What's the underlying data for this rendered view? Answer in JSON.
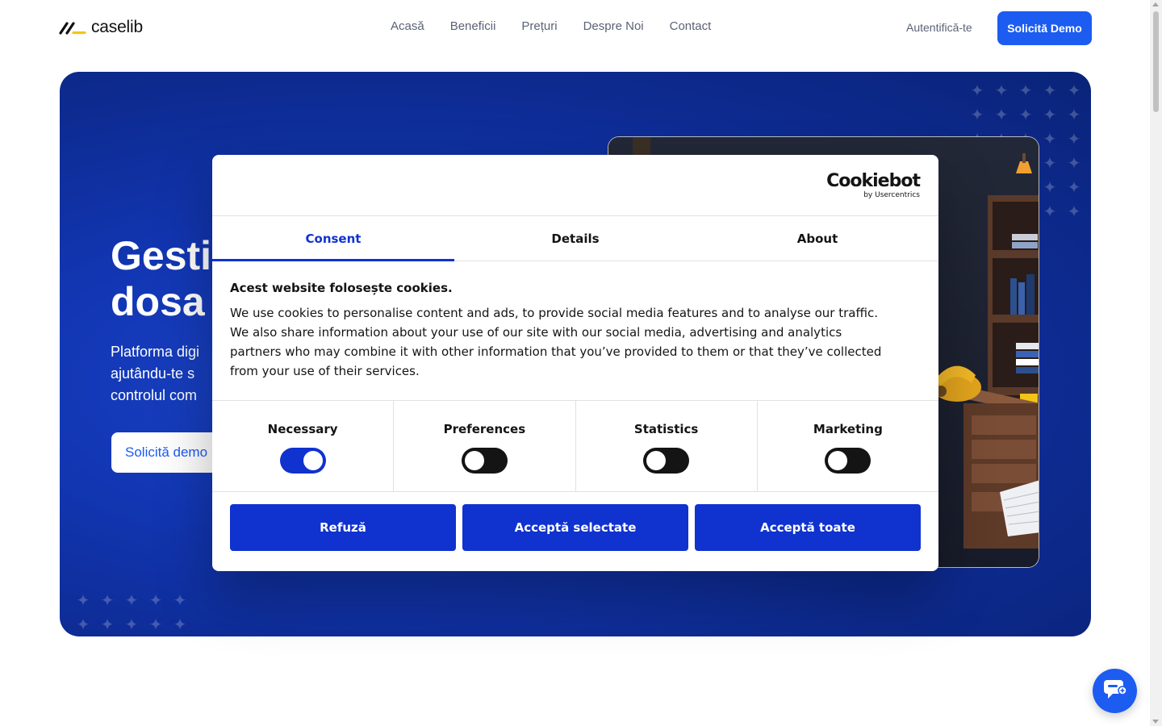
{
  "header": {
    "logo_text": "caselib",
    "nav": [
      "Acasă",
      "Beneficii",
      "Prețuri",
      "Despre Noi",
      "Contact"
    ],
    "login_label": "Autentifică-te",
    "demo_label": "Solicită Demo"
  },
  "hero": {
    "title": "Gesti\ndosa",
    "subtitle": "Platforma digi\najutându-te s\ncontrolul com",
    "cta_label": "Solicită demo"
  },
  "cookie_dialog": {
    "brand_name": "Cookiebot",
    "brand_by": "by Usercentrics",
    "tabs": [
      "Consent",
      "Details",
      "About"
    ],
    "active_tab": "Consent",
    "heading": "Acest website folosește cookies.",
    "body": "We use cookies to personalise content and ads, to provide social media features and to analyse our traffic. We also share information about your use of our site with our social media, advertising and analytics partners who may combine it with other information that you’ve provided to them or that they’ve collected from your use of their services.",
    "toggles": [
      {
        "label": "Necessary",
        "on": true
      },
      {
        "label": "Preferences",
        "on": false
      },
      {
        "label": "Statistics",
        "on": false
      },
      {
        "label": "Marketing",
        "on": false
      }
    ],
    "buttons": [
      "Refuză",
      "Acceptă selectate",
      "Acceptă toate"
    ]
  },
  "colors": {
    "brand_blue": "#1d5cf0",
    "dialog_blue": "#1032cf",
    "hero_dark": "#0a2479"
  },
  "icons": {
    "chat": "chat-bubble-icon",
    "logo_mark": "logo-slashes-icon"
  }
}
